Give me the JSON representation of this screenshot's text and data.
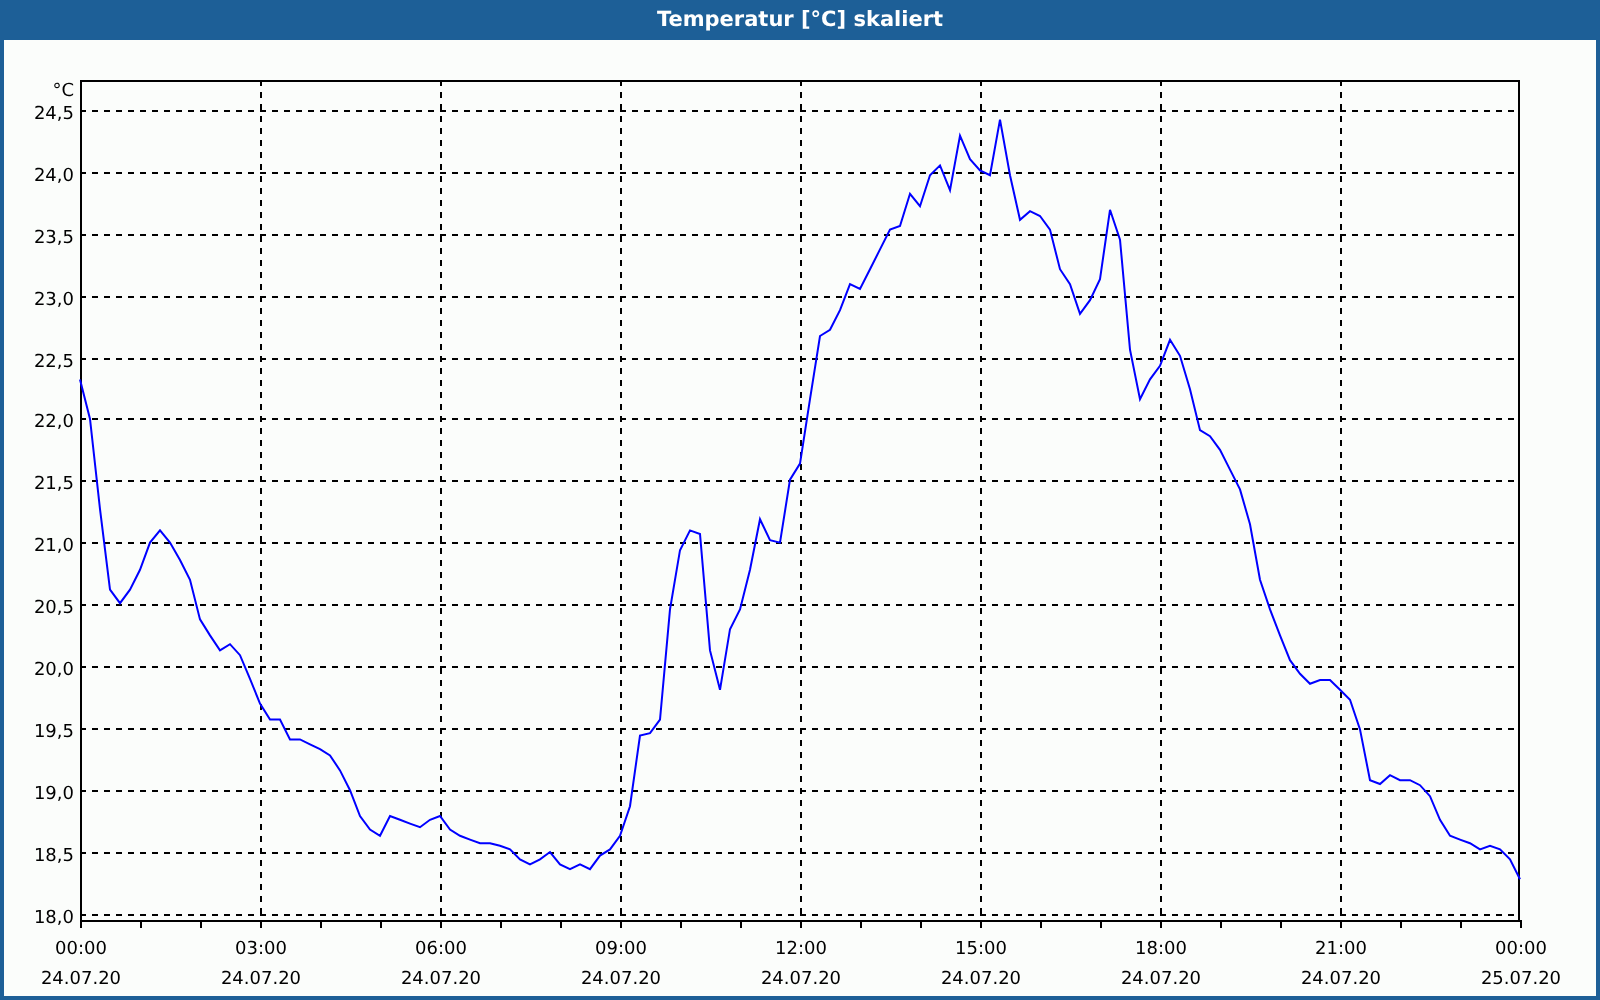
{
  "window": {
    "title": "Temperatur [°C] skaliert"
  },
  "chart_data": {
    "type": "line",
    "grid": true,
    "ylabel": "°C",
    "ylim": [
      17.95,
      24.74
    ],
    "categories": [
      "00:00\n24.07.20",
      null,
      null,
      null,
      null,
      null,
      null,
      null,
      null,
      null,
      null,
      null,
      null,
      null,
      null,
      null,
      null,
      null,
      "03:00\n24.07.20",
      null,
      null,
      null,
      null,
      null,
      null,
      null,
      null,
      null,
      null,
      null,
      null,
      null,
      null,
      null,
      null,
      null,
      "06:00\n24.07.20",
      null,
      null,
      null,
      null,
      null,
      null,
      null,
      null,
      null,
      null,
      null,
      null,
      null,
      null,
      null,
      null,
      null,
      "09:00\n24.07.20",
      null,
      null,
      null,
      null,
      null,
      null,
      null,
      null,
      null,
      null,
      null,
      null,
      null,
      null,
      null,
      null,
      null,
      "12:00\n24.07.20",
      null,
      null,
      null,
      null,
      null,
      null,
      null,
      null,
      null,
      null,
      null,
      null,
      null,
      null,
      null,
      null,
      null,
      "15:00\n24.07.20",
      null,
      null,
      null,
      null,
      null,
      null,
      null,
      null,
      null,
      null,
      null,
      null,
      null,
      null,
      null,
      null,
      null,
      "18:00\n24.07.20",
      null,
      null,
      null,
      null,
      null,
      null,
      null,
      null,
      null,
      null,
      null,
      null,
      null,
      null,
      null,
      null,
      null,
      "21:00\n24.07.20",
      null,
      null,
      null,
      null,
      null,
      null,
      null,
      null,
      null,
      null,
      null,
      null,
      null,
      null,
      null,
      null,
      null,
      "00:00\n25.07.20"
    ],
    "yticks": [
      {
        "value": 18,
        "label": "18,0"
      },
      {
        "value": 18.5,
        "label": "18,5"
      },
      {
        "value": 19,
        "label": "19,0"
      },
      {
        "value": 19.5,
        "label": "19,5"
      },
      {
        "value": 20,
        "label": "20,0"
      },
      {
        "value": 20.5,
        "label": "20,5"
      },
      {
        "value": 21,
        "label": "21,0"
      },
      {
        "value": 21.5,
        "label": "21,5"
      },
      {
        "value": 22,
        "label": "22,0"
      },
      {
        "value": 22.5,
        "label": "22,5"
      },
      {
        "value": 23,
        "label": "23,0"
      },
      {
        "value": 23.5,
        "label": "23,5"
      },
      {
        "value": 24,
        "label": "24,0"
      },
      {
        "value": 24.5,
        "label": "24,5"
      }
    ],
    "series": [
      {
        "color": "#0000ff",
        "values": [
          22.32,
          22.0,
          21.27,
          20.62,
          20.51,
          20.62,
          20.78,
          21.0,
          21.1,
          21.0,
          20.86,
          20.7,
          20.38,
          20.25,
          20.13,
          20.18,
          20.09,
          19.9,
          19.7,
          19.57,
          19.57,
          19.41,
          19.41,
          19.37,
          19.33,
          19.28,
          19.16,
          19.0,
          18.79,
          18.68,
          18.63,
          18.79,
          18.76,
          18.73,
          18.7,
          18.76,
          18.79,
          18.68,
          18.63,
          18.6,
          18.57,
          18.57,
          18.55,
          18.52,
          18.44,
          18.4,
          18.44,
          18.5,
          18.4,
          18.36,
          18.4,
          18.36,
          18.47,
          18.52,
          18.63,
          18.87,
          19.44,
          19.46,
          19.57,
          20.46,
          20.94,
          21.1,
          21.07,
          20.13,
          19.81,
          20.3,
          20.46,
          20.78,
          21.19,
          21.02,
          21.0,
          21.51,
          21.64,
          22.16,
          22.67,
          22.72,
          22.88,
          23.09,
          23.05,
          23.21,
          23.37,
          23.53,
          23.56,
          23.82,
          23.72,
          23.97,
          24.05,
          23.85,
          24.29,
          24.1,
          24.01,
          23.97,
          24.42,
          23.97,
          23.61,
          23.68,
          23.64,
          23.53,
          23.21,
          23.09,
          22.85,
          22.96,
          23.13,
          23.69,
          23.45,
          22.56,
          22.16,
          22.32,
          22.43,
          22.64,
          22.51,
          22.24,
          21.91,
          21.86,
          21.75,
          21.59,
          21.43,
          21.15,
          20.7,
          20.46,
          20.25,
          20.05,
          19.94,
          19.86,
          19.89,
          19.89,
          19.81,
          19.73,
          19.49,
          19.08,
          19.05,
          19.12,
          19.08,
          19.08,
          19.04,
          18.95,
          18.76,
          18.63,
          18.6,
          18.57,
          18.52,
          18.55,
          18.52,
          18.44,
          18.28
        ]
      }
    ]
  }
}
